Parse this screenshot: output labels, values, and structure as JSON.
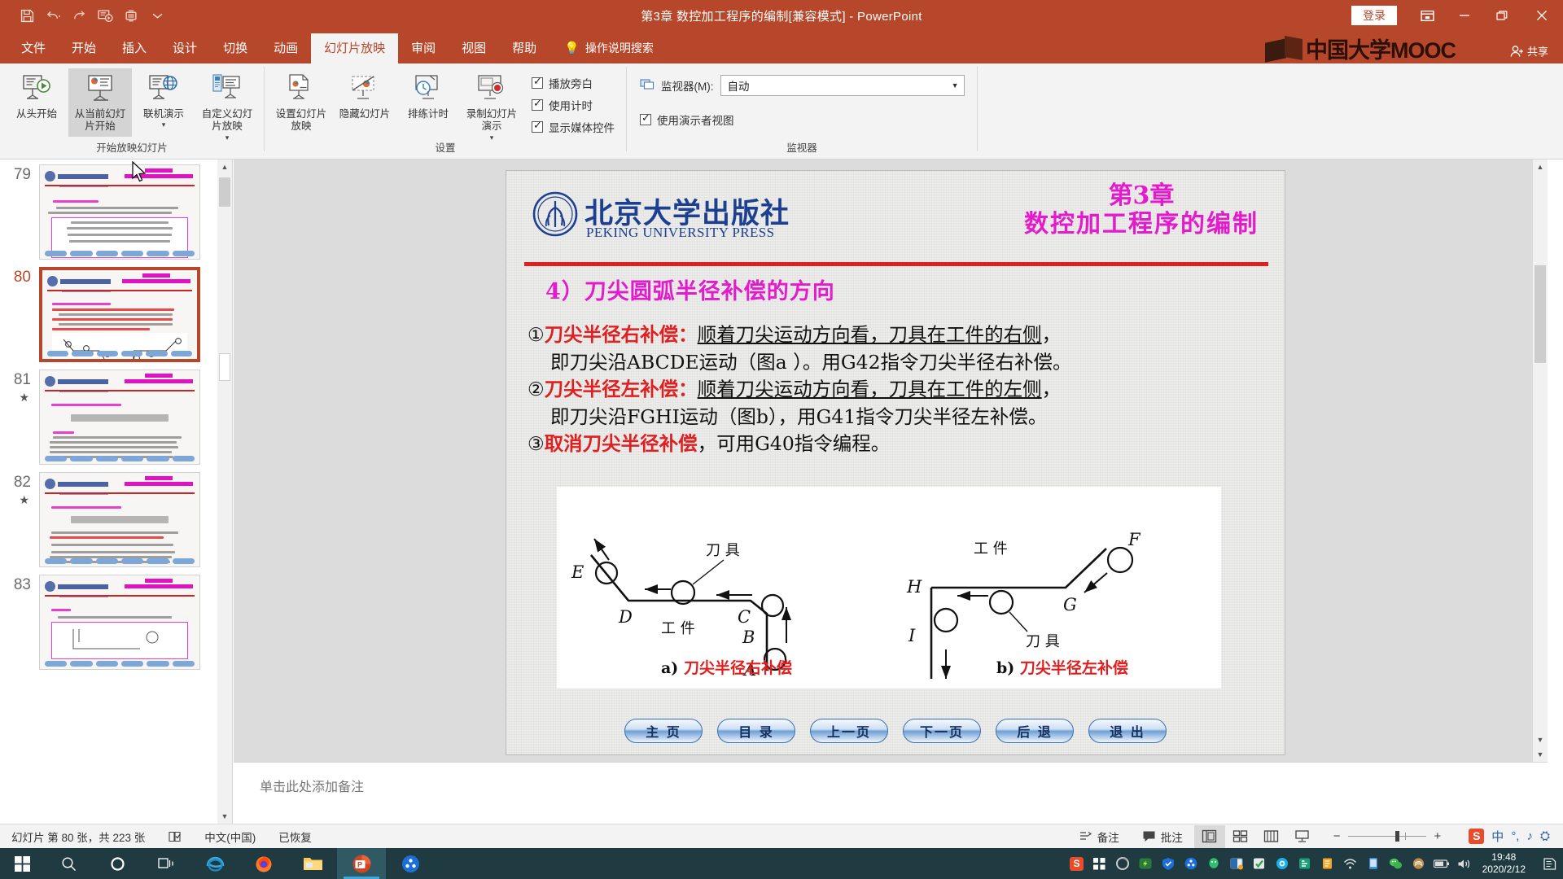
{
  "titlebar": {
    "title": "第3章 数控加工程序的编制[兼容模式] - PowerPoint",
    "signin_label": "登录",
    "qat": [
      {
        "name": "save-icon",
        "label": "保存"
      },
      {
        "name": "undo-icon",
        "label": "撤消"
      },
      {
        "name": "redo-icon",
        "label": "恢复"
      },
      {
        "name": "start-from-beginning-icon",
        "label": "从头开始"
      },
      {
        "name": "touch-mode-icon",
        "label": "触摸/鼠标模式"
      },
      {
        "name": "customize-qat-icon",
        "label": "自定义快速访问工具栏"
      }
    ],
    "window_controls": [
      "ribbon-display-options",
      "minimize",
      "restore",
      "close"
    ],
    "brand_text": "中国大学MOOC",
    "share_label": "共享"
  },
  "tabs": [
    {
      "label": "文件",
      "active": false
    },
    {
      "label": "开始",
      "active": false
    },
    {
      "label": "插入",
      "active": false
    },
    {
      "label": "设计",
      "active": false
    },
    {
      "label": "切换",
      "active": false
    },
    {
      "label": "动画",
      "active": false
    },
    {
      "label": "幻灯片放映",
      "active": true
    },
    {
      "label": "审阅",
      "active": false
    },
    {
      "label": "视图",
      "active": false
    },
    {
      "label": "帮助",
      "active": false
    }
  ],
  "tellme": "操作说明搜索",
  "ribbon": {
    "groups": [
      {
        "title": "开始放映幻灯片",
        "buttons": [
          {
            "label": "从头开始",
            "icon": "present-from-start-icon",
            "selected": false
          },
          {
            "label": "从当前幻灯片开始",
            "icon": "present-from-current-icon",
            "selected": true
          },
          {
            "label": "联机演示",
            "icon": "present-online-icon",
            "selected": false,
            "dropdown": true
          },
          {
            "label": "自定义幻灯片放映",
            "icon": "custom-slideshow-icon",
            "selected": false,
            "dropdown": true
          }
        ]
      },
      {
        "title": "设置",
        "buttons": [
          {
            "label": "设置幻灯片放映",
            "icon": "setup-slideshow-icon"
          },
          {
            "label": "隐藏幻灯片",
            "icon": "hide-slide-icon"
          },
          {
            "label": "排练计时",
            "icon": "rehearse-timings-icon"
          },
          {
            "label": "录制幻灯片演示",
            "icon": "record-slideshow-icon",
            "dropdown": true
          }
        ],
        "checkboxes": [
          {
            "label": "播放旁白",
            "checked": true
          },
          {
            "label": "使用计时",
            "checked": true
          },
          {
            "label": "显示媒体控件",
            "checked": true
          }
        ]
      },
      {
        "title": "监视器",
        "monitor_label": "监视器(M):",
        "monitor_value": "自动",
        "checkboxes": [
          {
            "label": "使用演示者视图",
            "checked": true
          }
        ]
      }
    ]
  },
  "thumbnails": [
    {
      "number": "79",
      "star": false,
      "current": false
    },
    {
      "number": "80",
      "star": false,
      "current": true
    },
    {
      "number": "81",
      "star": true,
      "current": false
    },
    {
      "number": "82",
      "star": true,
      "current": false
    },
    {
      "number": "83",
      "star": false,
      "current": false
    }
  ],
  "slide": {
    "publisher_cn": "北京大学出版社",
    "publisher_en": "PEKING UNIVERSITY PRESS",
    "chapter_line1": "第3章",
    "chapter_line2": "数控加工程序的编制",
    "section_heading": "4）刀尖圆弧半径补偿的方向",
    "body": [
      {
        "marker": "①",
        "term": "刀尖半径右补偿：",
        "underlined": "顺着刀尖运动方向看，刀具在工件的右侧",
        "tail": "，",
        "cont": "即刀尖沿ABCDE运动（图a ）。用G42指令刀尖半径右补偿。"
      },
      {
        "marker": "②",
        "term": "刀尖半径左补偿：",
        "underlined": "顺着刀尖运动方向看，刀具在工件的左侧",
        "tail": "，",
        "cont": "即刀尖沿FGHI运动（图b），用G41指令刀尖半径左补偿。"
      },
      {
        "marker": "③",
        "term": "取消刀尖半径补偿",
        "underlined": "",
        "tail": "，可用G40指令编程。",
        "cont": ""
      }
    ],
    "figure": {
      "left": {
        "points": [
          "E",
          "D",
          "C",
          "B",
          "A"
        ],
        "tool_label": "刀 具",
        "workpiece_label": "工 件",
        "caption_prefix": "a)",
        "caption": "刀尖半径右补偿"
      },
      "right": {
        "points": [
          "F",
          "G",
          "H",
          "I"
        ],
        "tool_label": "刀 具",
        "workpiece_label": "工 件",
        "caption_prefix": "b)",
        "caption": "刀尖半径左补偿"
      }
    },
    "nav_buttons": [
      "主 页",
      "目 录",
      "上一页",
      "下一页",
      "后 退",
      "退 出"
    ]
  },
  "notes_placeholder": "单击此处添加备注",
  "statusbar": {
    "slide_count": "幻灯片 第 80 张，共 223 张",
    "language": "中文(中国)",
    "autosave_state": "已恢复",
    "notes_label": "备注",
    "comments_label": "批注",
    "views": [
      "normal-view",
      "slide-sorter-view",
      "reading-view",
      "slideshow-view"
    ],
    "zoom_out": "−",
    "zoom_in": "+"
  },
  "taskbar": {
    "apps": [
      "start-icon",
      "search-icon",
      "cortana-icon",
      "task-view-icon",
      "internet-explorer-icon",
      "firefox-icon",
      "file-explorer-icon",
      "powerpoint-icon",
      "potplayer-icon"
    ],
    "tray": [
      "sogou-icon",
      "grid-icon",
      "chrome-icon",
      "thunder-icon",
      "tencent-icon",
      "potplayer-icon",
      "qq-icon",
      "kingsoft-icon",
      "360-icon",
      "wps-icon",
      "note-icon",
      "wifi-icon",
      "mobile-icon",
      "wechat-icon",
      "shield-icon",
      "battery-icon",
      "volume-icon"
    ],
    "time": "19:48",
    "date": "2020/2/12"
  },
  "colors": {
    "brand": "#b7472a",
    "slide_magenta": "#e31bcd",
    "slide_red": "#e02020",
    "pku_blue": "#1d3f91",
    "taskbar": "#1f3a40"
  }
}
